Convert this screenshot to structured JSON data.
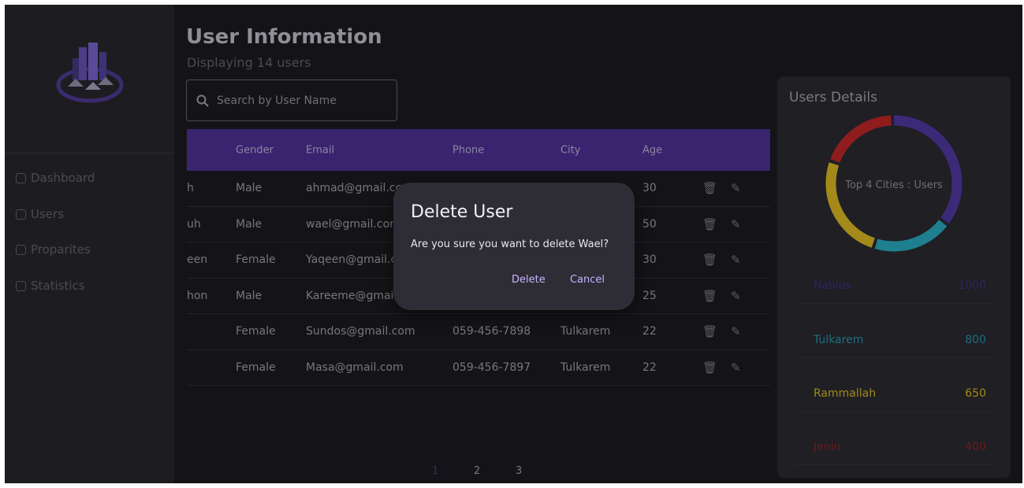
{
  "nav": {
    "items": [
      {
        "label": "Dashboard",
        "icon": "grid-icon"
      },
      {
        "label": "Users",
        "icon": "users-icon"
      },
      {
        "label": "Proparites",
        "icon": "home-icon"
      },
      {
        "label": "Statistics",
        "icon": "chart-icon"
      }
    ]
  },
  "header": {
    "title": "User Information",
    "subtitle": "Displaying 14 users"
  },
  "search": {
    "placeholder": "Search by User Name",
    "value": ""
  },
  "table": {
    "columns": [
      "Gender",
      "Email",
      "Phone",
      "City",
      "Age"
    ],
    "rows": [
      {
        "name": "h",
        "gender": "Male",
        "email": "ahmad@gmail.cc",
        "phone": "",
        "city": "",
        "age": "30"
      },
      {
        "name": "uh",
        "gender": "Male",
        "email": "wael@gmail.con",
        "phone": "",
        "city": "",
        "age": "50"
      },
      {
        "name": "een",
        "gender": "Female",
        "email": "Yaqeen@gmail.c",
        "phone": "",
        "city": "",
        "age": "30"
      },
      {
        "name": "hon",
        "gender": "Male",
        "email": "Kareeme@gmail",
        "phone": "",
        "city": "",
        "age": "25"
      },
      {
        "name": "",
        "gender": "Female",
        "email": "Sundos@gmail.com",
        "phone": "059-456-7898",
        "city": "Tulkarem",
        "age": "22"
      },
      {
        "name": "",
        "gender": "Female",
        "email": "Masa@gmail.com",
        "phone": "059-456-7897",
        "city": "Tulkarem",
        "age": "22"
      }
    ]
  },
  "pagination": {
    "pages": [
      "1",
      "2",
      "3"
    ],
    "current": "1"
  },
  "details": {
    "title": "Users Details",
    "donut_label": "Top 4 Cities : Users",
    "cities": [
      {
        "name": "Nablus",
        "value": "1000",
        "color": "#3b2a78"
      },
      {
        "name": "Tulkarem",
        "value": "800",
        "color": "#1e7f8f"
      },
      {
        "name": "Rammallah",
        "value": "650",
        "color": "#a38a1a"
      },
      {
        "name": "Jenin",
        "value": "400",
        "color": "#8f1d1d"
      }
    ]
  },
  "modal": {
    "title": "Delete User",
    "message": "Are you sure you want to delete Wael?",
    "delete_label": "Delete",
    "cancel_label": "Cancel"
  }
}
